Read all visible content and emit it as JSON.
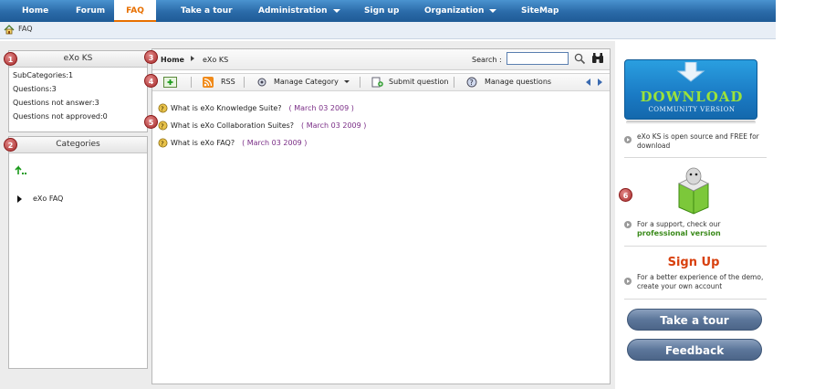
{
  "nav": {
    "items": [
      {
        "label": "Home"
      },
      {
        "label": "Forum"
      },
      {
        "label": "FAQ"
      },
      {
        "label": "Take a tour"
      },
      {
        "label": "Administration"
      },
      {
        "label": "Sign up"
      },
      {
        "label": "Organization"
      },
      {
        "label": "SiteMap"
      }
    ],
    "active": "FAQ"
  },
  "breadcrumb": {
    "current": "FAQ"
  },
  "left_panel": {
    "title": "eXo KS",
    "badge": "1",
    "stats": [
      {
        "label": "SubCategories:",
        "value": "1"
      },
      {
        "label": "Questions:",
        "value": "3"
      },
      {
        "label": "Questions not answer:",
        "value": "3"
      },
      {
        "label": "Questions not approved:",
        "value": "0"
      }
    ]
  },
  "categories_panel": {
    "title": "Categories",
    "badge": "2",
    "tree_item": "eXo FAQ"
  },
  "content": {
    "badge_path": "3",
    "path": {
      "home": "Home",
      "current": "eXo KS"
    },
    "search": {
      "label": "Search :",
      "value": ""
    },
    "badge_toolbar": "4",
    "toolbar": {
      "rss": "RSS",
      "manage_category": "Manage Category",
      "submit_question": "Submit question",
      "manage_questions": "Manage questions"
    },
    "badge_questions": "5",
    "questions": [
      {
        "title": "What is eXo Knowledge Suite?",
        "date": "( March 03 2009 )"
      },
      {
        "title": "What is eXo Collaboration Suites?",
        "date": "( March 03 2009 )"
      },
      {
        "title": "What is eXo FAQ?",
        "date": "( March 03 2009 )"
      }
    ]
  },
  "promo": {
    "badge": "6",
    "download": {
      "title": "DOWNLOAD",
      "subtitle": "COMMUNITY VERSION"
    },
    "open_source_text": "eXo KS is open source and FREE for download",
    "support_text": "For a support, check our",
    "support_link": "professional version",
    "signup_title": "Sign Up",
    "signup_text": "For a better experience of the demo, create your own account",
    "take_tour": "Take a tour",
    "feedback": "Feedback"
  },
  "colors": {
    "nav_bg": "#2a6aa8",
    "active_tab": "#e76f00",
    "date_color": "#7a2d86",
    "download_green": "#8fdc3a",
    "signup_red": "#d8400e",
    "support_link_green": "#3a8a1a"
  }
}
